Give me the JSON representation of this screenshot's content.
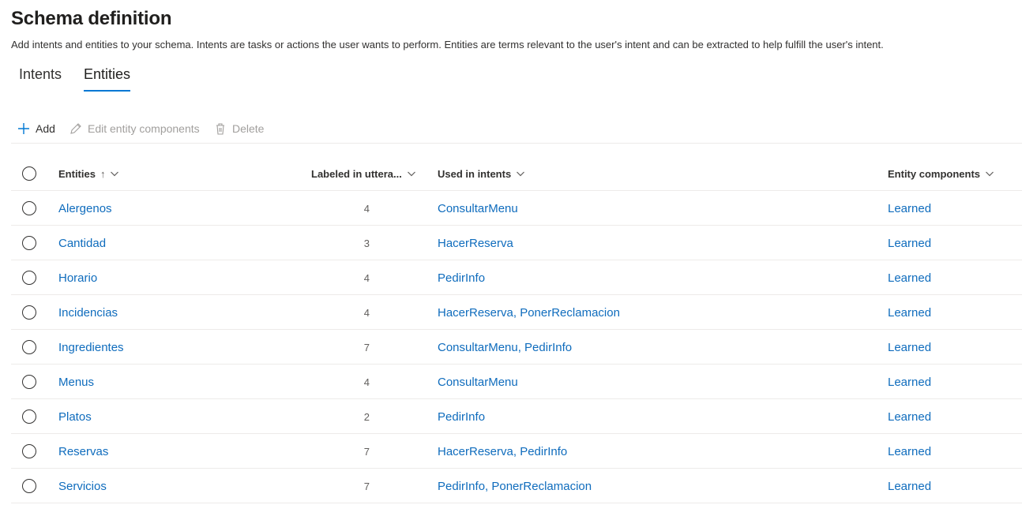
{
  "header": {
    "title": "Schema definition",
    "description": "Add intents and entities to your schema. Intents are tasks or actions the user wants to perform. Entities are terms relevant to the user's intent and can be extracted to help fulfill the user's intent."
  },
  "tabs": [
    {
      "label": "Intents",
      "selected": false
    },
    {
      "label": "Entities",
      "selected": true
    }
  ],
  "toolbar": {
    "add_label": "Add",
    "edit_label": "Edit entity components",
    "delete_label": "Delete"
  },
  "table": {
    "columns": {
      "entities": "Entities",
      "sort_indicator": "↑",
      "labeled": "Labeled in uttera...",
      "used_in": "Used in intents",
      "components": "Entity components"
    },
    "rows": [
      {
        "name": "Alergenos",
        "labeled": "4",
        "intents": "ConsultarMenu",
        "components": "Learned"
      },
      {
        "name": "Cantidad",
        "labeled": "3",
        "intents": "HacerReserva",
        "components": "Learned"
      },
      {
        "name": "Horario",
        "labeled": "4",
        "intents": "PedirInfo",
        "components": "Learned"
      },
      {
        "name": "Incidencias",
        "labeled": "4",
        "intents": "HacerReserva, PonerReclamacion",
        "components": "Learned"
      },
      {
        "name": "Ingredientes",
        "labeled": "7",
        "intents": "ConsultarMenu, PedirInfo",
        "components": "Learned"
      },
      {
        "name": "Menus",
        "labeled": "4",
        "intents": "ConsultarMenu",
        "components": "Learned"
      },
      {
        "name": "Platos",
        "labeled": "2",
        "intents": "PedirInfo",
        "components": "Learned"
      },
      {
        "name": "Reservas",
        "labeled": "7",
        "intents": "HacerReserva, PedirInfo",
        "components": "Learned"
      },
      {
        "name": "Servicios",
        "labeled": "7",
        "intents": "PedirInfo, PonerReclamacion",
        "components": "Learned"
      }
    ]
  },
  "colors": {
    "accent": "#0078d4",
    "link": "#0f6cbd",
    "disabled": "#a19f9d"
  }
}
